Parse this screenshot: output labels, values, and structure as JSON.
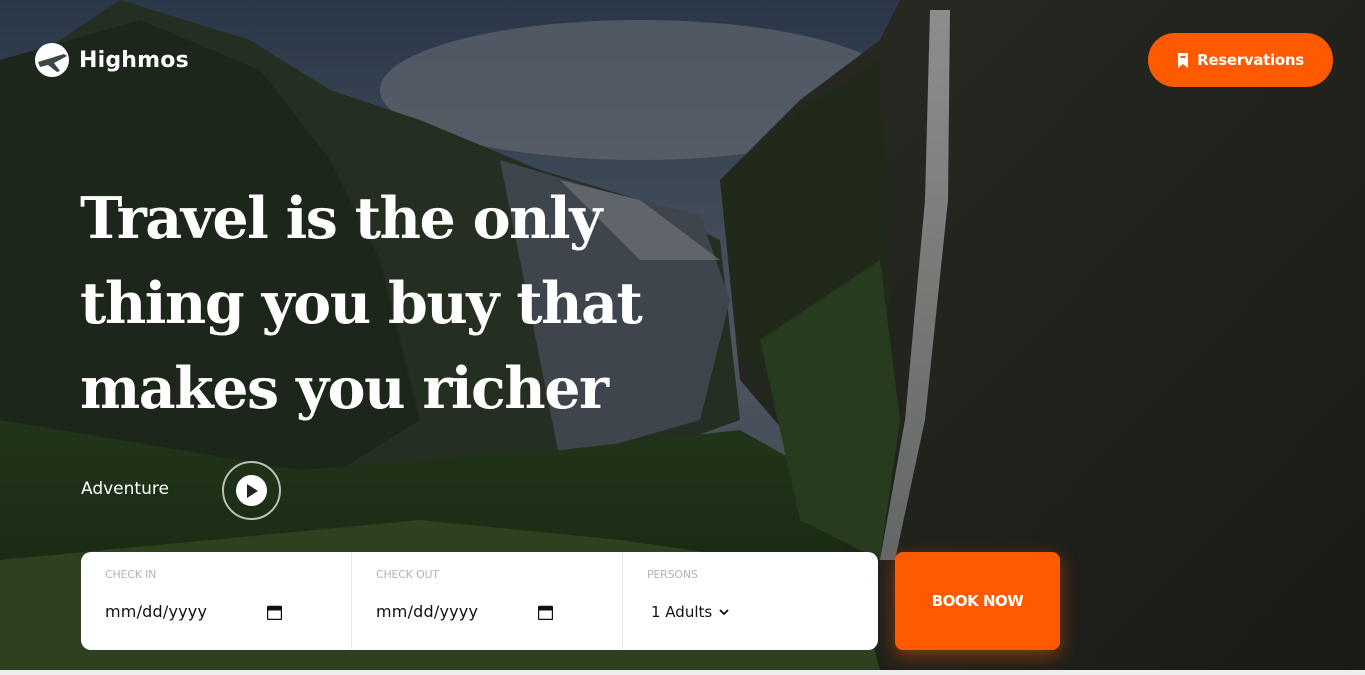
{
  "brand": {
    "name": "Highmos"
  },
  "header": {
    "reservations_label": "Reservations"
  },
  "hero": {
    "headline_lines": [
      "Travel is the only",
      "thing you buy that",
      "makes you richer"
    ],
    "adventure_label": "Adventure"
  },
  "booking": {
    "check_in": {
      "label": "CHECK IN",
      "placeholder": "mm/dd/yyyy"
    },
    "check_out": {
      "label": "CHECK OUT",
      "placeholder": "mm/dd/yyyy"
    },
    "persons": {
      "label": "PERSONS",
      "selected": "1 Adults"
    },
    "book_label": "BOOK NOW"
  },
  "icons": {
    "logo": "airplane-logo-icon",
    "reservations": "bookmark-icon",
    "play": "play-icon",
    "calendar": "calendar-icon",
    "dropdown": "chevron-down-icon"
  },
  "colors": {
    "accent": "#ff5a00",
    "text_on_dark": "#ffffff"
  }
}
